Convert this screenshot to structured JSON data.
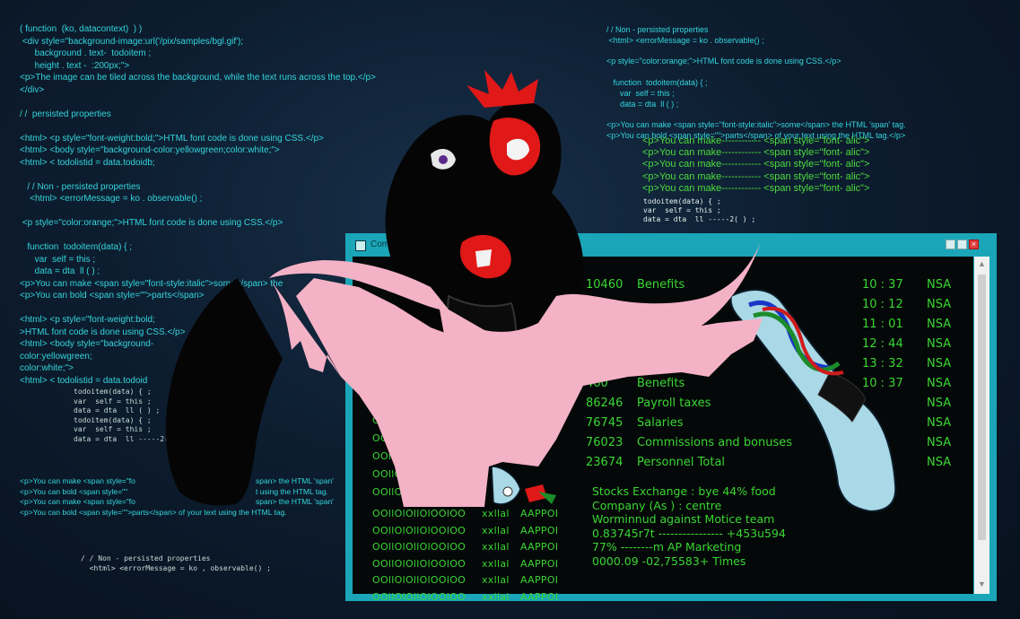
{
  "code_left": [
    "( function  (ko, datacontext)  ) )",
    " <div style=\"background-image:url('/pix/samples/bgl.gif');",
    "      background . text-  todoitem ;",
    "      height . text -  :200px;\">",
    "<p>The image can be tiled across the background, while the text runs across the top.</p>",
    "</div>",
    "",
    "/ /  persisted properties",
    "",
    "<html> <p style=\"font-weight:bold;\">HTML font code is done using CSS.</p>",
    "<html> <body style=\"background-color:yellowgreen;color:white;\">",
    "<html> < todolistid = data.todoidb;",
    "",
    "   / / Non - persisted properties",
    "    <html> <errorMessage = ko . observable() ;",
    "",
    " <p style=\"color:orange;\">HTML font code is done using CSS.</p>",
    "",
    "   function  todoitem(data) { ;",
    "      var  self = this ;",
    "      data = dta  ll ( ) ;",
    "<p>You can make <span style=\"font-style:italic\">some</span> the",
    "<p>You can bold <span style=\"\">parts</span>",
    "",
    "<html> <p style=\"font-weight:bold;",
    ">HTML font code is done using CSS.</p>",
    "<html> <body style=\"background-",
    "color:yellowgreen;",
    "color:white;\">",
    "<html> < todolistid = data.todoid"
  ],
  "code_small_left": [
    "todoitem(data) { ;",
    "var  self = this ;",
    "data = dta  ll ( ) ;",
    "todoitem(data) { ;",
    "var  self = this ;",
    "data = dta  ll -----2("
  ],
  "code_bottom_left": [
    "<p>You can make <span style=\"fo",
    "<p>You can bold <span style=\"\"",
    "<p>You can make <span style=\"fo",
    "<p>You can bold <span style=\"\">parts</span> of your text using the HTML tag."
  ],
  "code_bottom_left_right": [
    "span> the HTML 'span'",
    "t using the HTML tag.",
    "span> the HTML 'span'",
    ""
  ],
  "code_footer_left": [
    "/ / Non - persisted properties",
    "  <html> <errorMessage = ko , observable() ;"
  ],
  "code_right": [
    "/ / Non - persisted properties",
    " <html> <errorMessage = ko . observable() ;",
    "",
    "<p style=\"color:orange;\">HTML font code is done using CSS.</p>",
    "",
    "   function  todoitem(data) { ;",
    "      var  self = this ;",
    "      data = dta  ll ( ) ;",
    "",
    "<p>You can make <span style=\"font-style:italic\">some</span> the HTML 'span' tag.",
    "<p>You can bold <span style=\"\">parts</span> of your text using the HTML tag.</p>"
  ],
  "code_green": [
    "<p>You can make------------ <span style=\"font- alic\">",
    "<p>You can make------------ <span style=\"font- alic\">",
    "<p>You can make------------ <span style=\"font- alic\">",
    "<p>You can make------------ <span style=\"font- alic\">",
    "<p>You can make------------ <span style=\"font- alic\">"
  ],
  "code_white": [
    "todoitem(data) { ;",
    "var  self = this ;",
    "data = dta  ll -----2( ) ;"
  ],
  "terminal": {
    "title": "Com",
    "close_label": "×",
    "rows": [
      {
        "code": "10460",
        "label": "Benefits",
        "time": "10 : 37",
        "tag": "NSA"
      },
      {
        "code": "",
        "label": "",
        "time": "10 : 12",
        "tag": "NSA"
      },
      {
        "code": "",
        "label": "",
        "time": "11 : 01",
        "tag": "NSA"
      },
      {
        "code": "",
        "label": "",
        "time": "12 : 44",
        "tag": "NSA"
      },
      {
        "code": "74",
        "label": "",
        "time": "13 : 32",
        "tag": "NSA"
      },
      {
        "code": "460",
        "label": "Benefits",
        "time": "10 : 37",
        "tag": "NSA"
      },
      {
        "code": "86246",
        "label": "Payroll taxes",
        "time": "",
        "tag": "NSA"
      },
      {
        "code": "76745",
        "label": "Salaries",
        "time": "",
        "tag": "NSA"
      },
      {
        "code": "76023",
        "label": "Commissions and bonuses",
        "time": "",
        "tag": "NSA"
      },
      {
        "code": "23674",
        "label": "Personnel Total",
        "time": "",
        "tag": "NSA"
      }
    ],
    "binary_prefix": [
      "OOllO",
      "OOllO",
      "OOllO",
      "OOllO",
      "OOllO",
      "OOllO"
    ],
    "binary_rows": [
      {
        "bits": "OOllOlOllOlOOlOO",
        "mid": "xxllal",
        "end": "AAPPOI"
      },
      {
        "bits": "OOllOlOllOlOOlOO",
        "mid": "xxllal",
        "end": "AAPPOI"
      },
      {
        "bits": "OOllOlOllOlOOlOO",
        "mid": "xxllal",
        "end": "AAPPOI"
      },
      {
        "bits": "OOllOlOllOlOOlOO",
        "mid": "xxllal",
        "end": "AAPPOI"
      },
      {
        "bits": "OOllOlOllOlOOlOO",
        "mid": "xxllal",
        "end": "AAPPOI"
      },
      {
        "bits": "OOllOlOllOlOOlOO",
        "mid": "xxllal",
        "end": "AAPPOI"
      }
    ],
    "status_lines": [
      "Stocks Exchange : bye 44% food",
      "Company (As ) : centre",
      "Worminnud  against Motice team",
      "0.83745r7t  ----------------  +453u594",
      "77% --------m AP Marketing",
      "0000.09 -02,75583+ Times"
    ]
  },
  "colors": {
    "background": "#0d1d30",
    "code_cyan": "#33d6dc",
    "terminal_frame": "#1aa6b8",
    "terminal_text": "#3ad634",
    "creature_body": "#050505",
    "creature_wings": "#f4b2c6",
    "creature_red": "#e01818",
    "hand_blue": "#a9d8e6"
  }
}
